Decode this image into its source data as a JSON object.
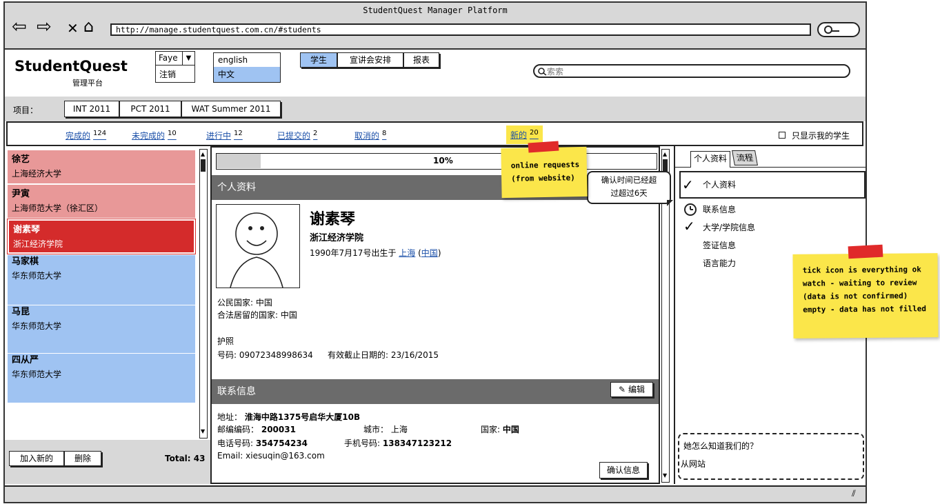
{
  "browser": {
    "title": "StudentQuest Manager Platform",
    "url": "http://manage.studentquest.com.cn/#students"
  },
  "header": {
    "logo": "StudentQuest",
    "subtitle": "管理平台",
    "user": "Faye",
    "logout": "注销",
    "languages": [
      "english",
      "中文"
    ],
    "nav": [
      "学生",
      "宣讲会安排",
      "报表"
    ],
    "search_placeholder": "索索"
  },
  "projects": {
    "label": "项目：",
    "items": [
      "INT 2011",
      "PCT 2011",
      "WAT Summer 2011"
    ]
  },
  "filters": [
    {
      "label": "完成的",
      "count": "124"
    },
    {
      "label": "未完成的",
      "count": "10"
    },
    {
      "label": "进行中",
      "count": "12"
    },
    {
      "label": "已提交的",
      "count": "2"
    },
    {
      "label": "取消的",
      "count": "8"
    },
    {
      "label": "新的",
      "count": "20"
    }
  ],
  "show_mine": "只显示我的学生",
  "students": [
    {
      "name": "徐艺",
      "school": "上海经济大学"
    },
    {
      "name": "尹寅",
      "school": "上海师范大学（徐汇区）"
    },
    {
      "name": "谢素琴",
      "school": "浙江经济学院"
    },
    {
      "name": "马家棋",
      "school": "华东师范大学"
    },
    {
      "name": "马昆",
      "school": "华东师范大学"
    },
    {
      "name": "四从严",
      "school": "华东师范大学"
    }
  ],
  "list_footer": {
    "add": "加入新的",
    "delete": "删除",
    "total": "Total: 43"
  },
  "progress": {
    "label": "10%",
    "value": 0.1
  },
  "profile": {
    "section_title": "个人资料",
    "name": "谢素琴",
    "school": "浙江经济学院",
    "birth_prefix": "1990年7月17号出生于",
    "birth_city": "上海",
    "birth_country": "中国",
    "citizenship": "公民国家: 中国",
    "residence": "合法居留的国家: 中国",
    "passport_title": "护照",
    "passport_no": "号码: 09072348998634",
    "passport_expiry": "有效截止日期的: 23/16/2015"
  },
  "contact": {
    "section_title": "联系信息",
    "edit": "编辑",
    "address_label": "地址：",
    "address": "淮海中路1375号启华大厦10B",
    "postcode_label": "邮编编码：",
    "postcode": "200031",
    "city_label": "城市：",
    "city": "上海",
    "country_label": "国家:",
    "country": "中国",
    "phone_label": "电话号码:",
    "phone": "354754234",
    "mobile_label": "手机号码:",
    "mobile": "138347123212",
    "email_label": "Email:",
    "email": "xiesuqin@163.com",
    "confirm": "确认信息"
  },
  "warning_bubble": {
    "line1": "确认时间已经超",
    "line2": "过超过6天"
  },
  "right_panel": {
    "tabs": [
      "个人资料",
      "流程"
    ],
    "steps": [
      {
        "label": "个人资料",
        "status": "check"
      },
      {
        "label": "联系信息",
        "status": "clock"
      },
      {
        "label": "大学/学院信息",
        "status": "check"
      },
      {
        "label": "签证信息",
        "status": "empty"
      },
      {
        "label": "语言能力",
        "status": "empty"
      }
    ],
    "how_question": "她怎么知道我们的？",
    "how_answer": "从网站"
  },
  "notes": {
    "new_requests": [
      "online requests",
      "(from website)"
    ],
    "legend": [
      "tick icon is everything ok",
      "watch - waiting to review",
      "(data is not confirmed)",
      "empty - data has not filled"
    ]
  },
  "colors": {
    "selected_student": "#d42b2b",
    "pink_student": "#e89898",
    "blue_student": "#9fc3f2",
    "sticky": "#fbe64a",
    "section_head": "#6b6b6b"
  }
}
